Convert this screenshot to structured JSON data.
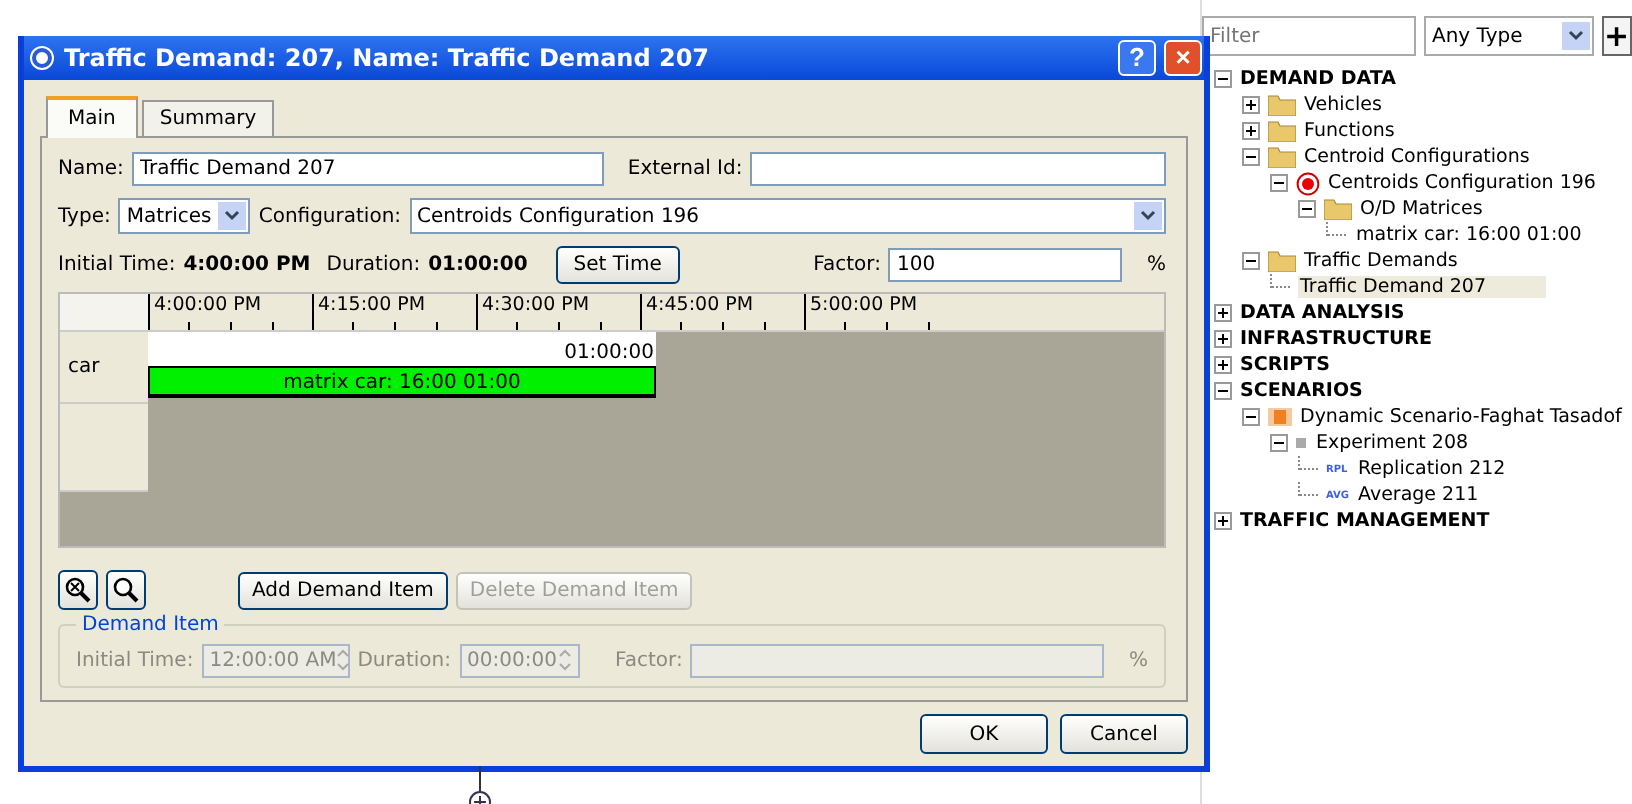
{
  "dialog": {
    "title": "Traffic Demand: 207, Name: Traffic Demand 207",
    "help": "?",
    "close": "×",
    "tabs": [
      {
        "label": "Main",
        "selected": true
      },
      {
        "label": "Summary",
        "selected": false
      }
    ],
    "name_label": "Name:",
    "name_value": "Traffic Demand 207",
    "external_id_label": "External Id:",
    "type_label": "Type:",
    "type_value": "Matrices",
    "configuration_label": "Configuration:",
    "configuration_value": "Centroids Configuration 196",
    "initial_time_label": "Initial Time:",
    "initial_time_value": "4:00:00 PM",
    "duration_label": "Duration:",
    "duration_value": "01:00:00",
    "set_time_button": "Set Time",
    "factor_label": "Factor:",
    "factor_value": "100",
    "percent": "%",
    "timeline": {
      "ticks": [
        "4:00:00 PM",
        "4:15:00 PM",
        "4:30:00 PM",
        "4:45:00 PM",
        "5:00:00 PM"
      ],
      "rows": [
        {
          "label": "car",
          "duration": "01:00:00",
          "item": "matrix car: 16:00 01:00"
        }
      ]
    },
    "add_button": {
      "label": "Add Demand Item",
      "disabled": false
    },
    "delete_button": {
      "label": "Delete Demand Item",
      "disabled": true
    },
    "demand_item": {
      "legend": "Demand Item",
      "initial_time_label": "Initial Time:",
      "initial_time_value": "12:00:00 AM",
      "duration_label": "Duration:",
      "duration_value": "00:00:00",
      "factor_label": "Factor:",
      "percent": "%"
    },
    "ok_button": "OK",
    "cancel_button": "Cancel"
  },
  "panel": {
    "filter_placeholder": "Filter",
    "type_value": "Any Type",
    "add": "+",
    "tree": [
      {
        "label": "DEMAND DATA",
        "kind": "category",
        "expanded": true,
        "children": [
          {
            "label": "Vehicles",
            "kind": "folder",
            "expanded": false
          },
          {
            "label": "Functions",
            "kind": "folder",
            "expanded": false
          },
          {
            "label": "Centroid Configurations",
            "kind": "folder",
            "expanded": true,
            "children": [
              {
                "label": "Centroids Configuration 196",
                "kind": "centroid",
                "expanded": true,
                "children": [
                  {
                    "label": "O/D Matrices",
                    "kind": "folder",
                    "expanded": true,
                    "children": [
                      {
                        "label": "matrix car: 16:00 01:00",
                        "kind": "leaf"
                      }
                    ]
                  }
                ]
              }
            ]
          },
          {
            "label": "Traffic Demands",
            "kind": "folder",
            "expanded": true,
            "children": [
              {
                "label": "Traffic Demand 207",
                "kind": "leaf",
                "selected": true
              }
            ]
          }
        ]
      },
      {
        "label": "DATA ANALYSIS",
        "kind": "category",
        "expanded": false
      },
      {
        "label": "INFRASTRUCTURE",
        "kind": "category",
        "expanded": false
      },
      {
        "label": "SCRIPTS",
        "kind": "category",
        "expanded": false
      },
      {
        "label": "SCENARIOS",
        "kind": "category",
        "expanded": true,
        "children": [
          {
            "label": "Dynamic Scenario-Faghat Tasadof",
            "kind": "scenario",
            "expanded": true,
            "children": [
              {
                "label": "Experiment 208",
                "kind": "experiment",
                "expanded": true,
                "children": [
                  {
                    "label": "Replication 212",
                    "kind": "badge",
                    "badge": "RPL"
                  },
                  {
                    "label": "Average 211",
                    "kind": "badge",
                    "badge": "AVG"
                  }
                ]
              }
            ]
          }
        ]
      },
      {
        "label": "TRAFFIC MANAGEMENT",
        "kind": "category",
        "expanded": false
      }
    ]
  }
}
